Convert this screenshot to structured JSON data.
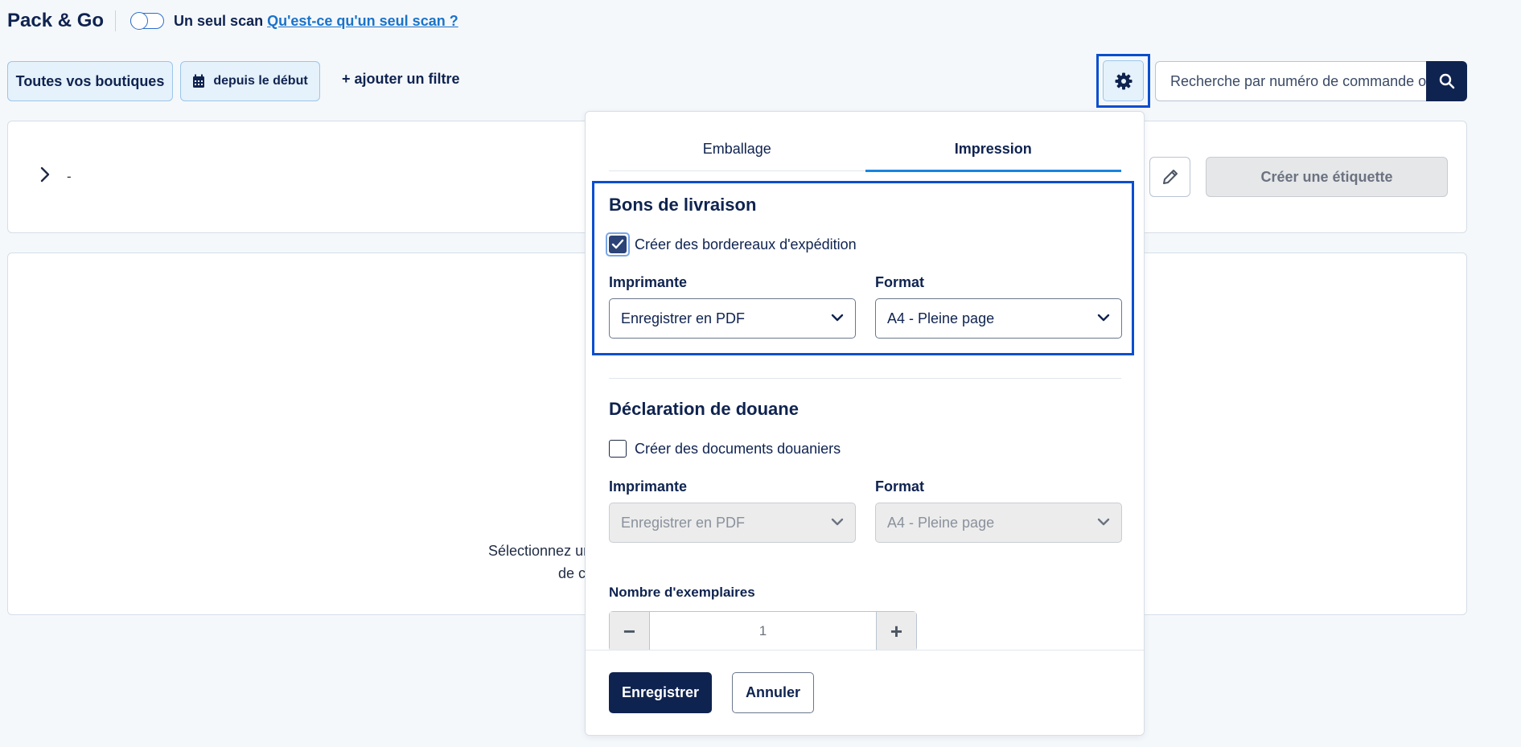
{
  "header": {
    "brand": "Pack & Go",
    "single_scan_label": "Un seul scan",
    "single_scan_help_link": "Qu'est-ce qu'un seul scan ?"
  },
  "filters": {
    "shops_label": "Toutes vos boutiques",
    "date_label": "depuis le début",
    "add_filter_label": "+ ajouter un filtre"
  },
  "search": {
    "placeholder": "Recherche par numéro de commande o"
  },
  "order_card": {
    "value": "-",
    "create_label_button": "Créer une étiquette"
  },
  "empty_state": {
    "line1": "Sélectionnez ur",
    "line2": "de co"
  },
  "settings_panel": {
    "tabs": [
      {
        "label": "Emballage",
        "active": false
      },
      {
        "label": "Impression",
        "active": true
      }
    ],
    "delivery_notes": {
      "title": "Bons de livraison",
      "checkbox_label": "Créer des bordereaux d'expédition",
      "checked": true,
      "printer_label": "Imprimante",
      "printer_value": "Enregistrer en PDF",
      "format_label": "Format",
      "format_value": "A4 - Pleine page"
    },
    "customs": {
      "title": "Déclaration de douane",
      "checkbox_label": "Créer des documents douaniers",
      "checked": false,
      "printer_label": "Imprimante",
      "printer_value": "Enregistrer en PDF",
      "format_label": "Format",
      "format_value": "A4 - Pleine page"
    },
    "copies": {
      "label": "Nombre d'exemplaires",
      "value": "1",
      "minus": "−",
      "plus": "+"
    },
    "save_button": "Enregistrer",
    "cancel_button": "Annuler"
  },
  "colors": {
    "navy": "#0f2350",
    "accent": "#1a84e0",
    "highlight": "#0a4ecf"
  }
}
